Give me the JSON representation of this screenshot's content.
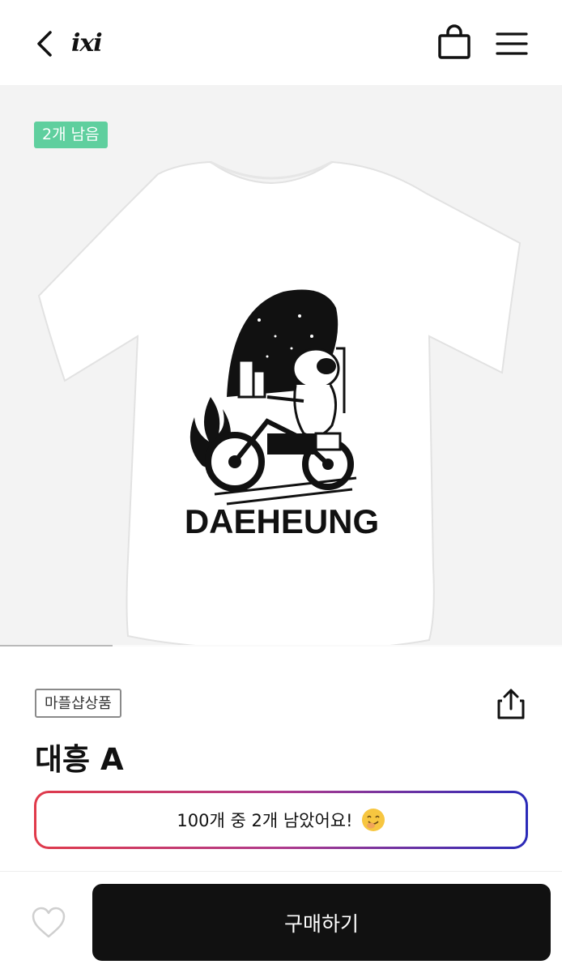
{
  "header": {
    "logo": "ixi",
    "icons": {
      "back": "chevron-left-icon",
      "cart": "shopping-bag-icon",
      "menu": "hamburger-menu-icon"
    }
  },
  "product_image": {
    "stock_badge": "2개 남음",
    "print_text": "DAEHEUNG",
    "carousel_progress": 0.2
  },
  "product": {
    "tag": "마플샵상품",
    "title": "대흥 A",
    "stock_alert": "100개 중 2개 남았어요!"
  },
  "bottom_bar": {
    "buy_label": "구매하기"
  },
  "colors": {
    "badge": "#5fcf9e",
    "buy_button": "#111111",
    "alert_gradient_start": "#e03a4a",
    "alert_gradient_end": "#2a2ab8"
  }
}
